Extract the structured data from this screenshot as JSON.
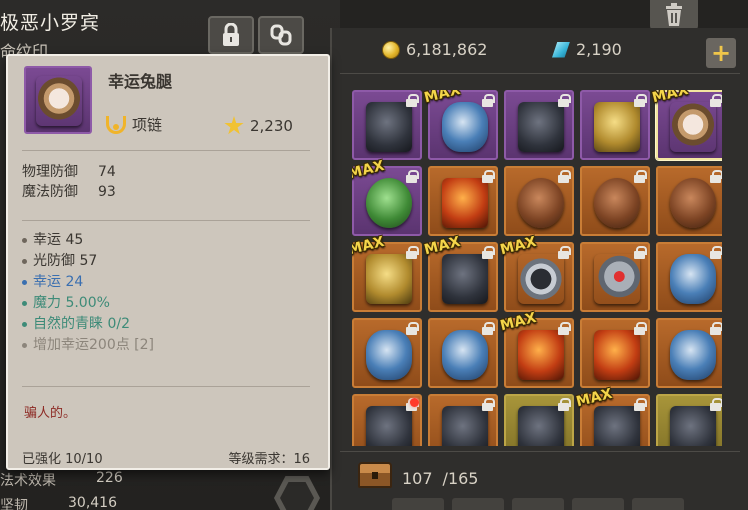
{
  "background": {
    "character_name": "极恶小罗宾",
    "sub_label": "命纹印",
    "stats": [
      {
        "label": "法术效果",
        "value": "226"
      },
      {
        "label": "坚韧",
        "value": "30,416"
      }
    ]
  },
  "currency": {
    "gold": "6,181,862",
    "gems": "2,190",
    "add_label": "+"
  },
  "tooltip": {
    "name": "幸运兔腿",
    "type_label": "项链",
    "power": "2,230",
    "defenses": [
      {
        "label": "物理防御",
        "value": "74"
      },
      {
        "label": "魔法防御",
        "value": "93"
      }
    ],
    "attributes": [
      {
        "text": "幸运 45",
        "color": "#3a3631",
        "bullet": "#6e665c"
      },
      {
        "text": "光防御 57",
        "color": "#3a3631",
        "bullet": "#6e665c"
      },
      {
        "text": "幸运 24",
        "color": "#3a6fb0",
        "bullet": "#3a6fb0"
      },
      {
        "text": "魔力 5.00%",
        "color": "#3d8b78",
        "bullet": "#3d8b78"
      },
      {
        "text": "自然的青睐 0/2",
        "color": "#3d8b78",
        "bullet": "#3d8b78"
      },
      {
        "text": "增加幸运200点 [2]",
        "color": "#8c857b",
        "bullet": "#8c857b"
      }
    ],
    "flavor": "骗人的。",
    "enhance": "已强化 10/10",
    "level_req": "等级需求：16"
  },
  "inventory": {
    "max_badge": "MAX",
    "capacity_used": "107",
    "capacity_sep": "/",
    "capacity_total": "165",
    "items": [
      {
        "name": "gas-mask-boots",
        "rarity": "purple",
        "art": "dark",
        "max": false,
        "selected": false
      },
      {
        "name": "blue-gauntlet",
        "rarity": "purple",
        "art": "blue",
        "max": true,
        "selected": false
      },
      {
        "name": "shadow-cloak",
        "rarity": "purple",
        "art": "dark",
        "max": false,
        "selected": false
      },
      {
        "name": "golden-boots",
        "rarity": "purple",
        "art": "gold",
        "max": false,
        "selected": false
      },
      {
        "name": "lucky-rabbit-foot",
        "rarity": "purple",
        "art": "rabbit",
        "max": true,
        "selected": true
      },
      {
        "name": "clover-charm",
        "rarity": "purple",
        "art": "green",
        "max": true,
        "selected": false
      },
      {
        "name": "demon-mask",
        "rarity": "orange",
        "art": "fire",
        "max": false,
        "selected": false
      },
      {
        "name": "goggles",
        "rarity": "orange",
        "art": "rust",
        "max": false,
        "selected": false
      },
      {
        "name": "goggles",
        "rarity": "orange",
        "art": "rust",
        "max": false,
        "selected": false
      },
      {
        "name": "goggles",
        "rarity": "orange",
        "art": "rust",
        "max": false,
        "selected": false
      },
      {
        "name": "bird-mask",
        "rarity": "orange",
        "art": "gold",
        "max": true,
        "selected": false
      },
      {
        "name": "spiked-gauntlet",
        "rarity": "orange",
        "art": "dark",
        "max": true,
        "selected": false
      },
      {
        "name": "silver-pendant",
        "rarity": "orange",
        "art": "ring",
        "max": true,
        "selected": false
      },
      {
        "name": "ruby-ring",
        "rarity": "orange",
        "art": "redring",
        "max": false,
        "selected": false
      },
      {
        "name": "spiked-skull-helm",
        "rarity": "orange",
        "art": "blue",
        "max": false,
        "selected": false
      },
      {
        "name": "spiked-skull-helm",
        "rarity": "orange",
        "art": "blue",
        "max": false,
        "selected": false
      },
      {
        "name": "spiked-skull-helm",
        "rarity": "orange",
        "art": "blue",
        "max": false,
        "selected": false
      },
      {
        "name": "flame-staff",
        "rarity": "orange",
        "art": "fire",
        "max": true,
        "selected": false
      },
      {
        "name": "flame-sword",
        "rarity": "orange",
        "art": "fire",
        "max": false,
        "selected": false
      },
      {
        "name": "bone-chain",
        "rarity": "orange",
        "art": "blue",
        "max": false,
        "selected": false
      },
      {
        "name": "dark-armor",
        "rarity": "orange",
        "art": "dark",
        "max": false,
        "selected": false,
        "alert": true
      },
      {
        "name": "dark-armor",
        "rarity": "orange",
        "art": "dark",
        "max": false,
        "selected": false
      },
      {
        "name": "iron-helm",
        "rarity": "yellow",
        "art": "dark",
        "max": false,
        "selected": false
      },
      {
        "name": "horned-helm",
        "rarity": "orange",
        "art": "dark",
        "max": true,
        "selected": false
      },
      {
        "name": "dark-shard",
        "rarity": "yellow",
        "art": "dark",
        "max": false,
        "selected": false
      }
    ]
  }
}
